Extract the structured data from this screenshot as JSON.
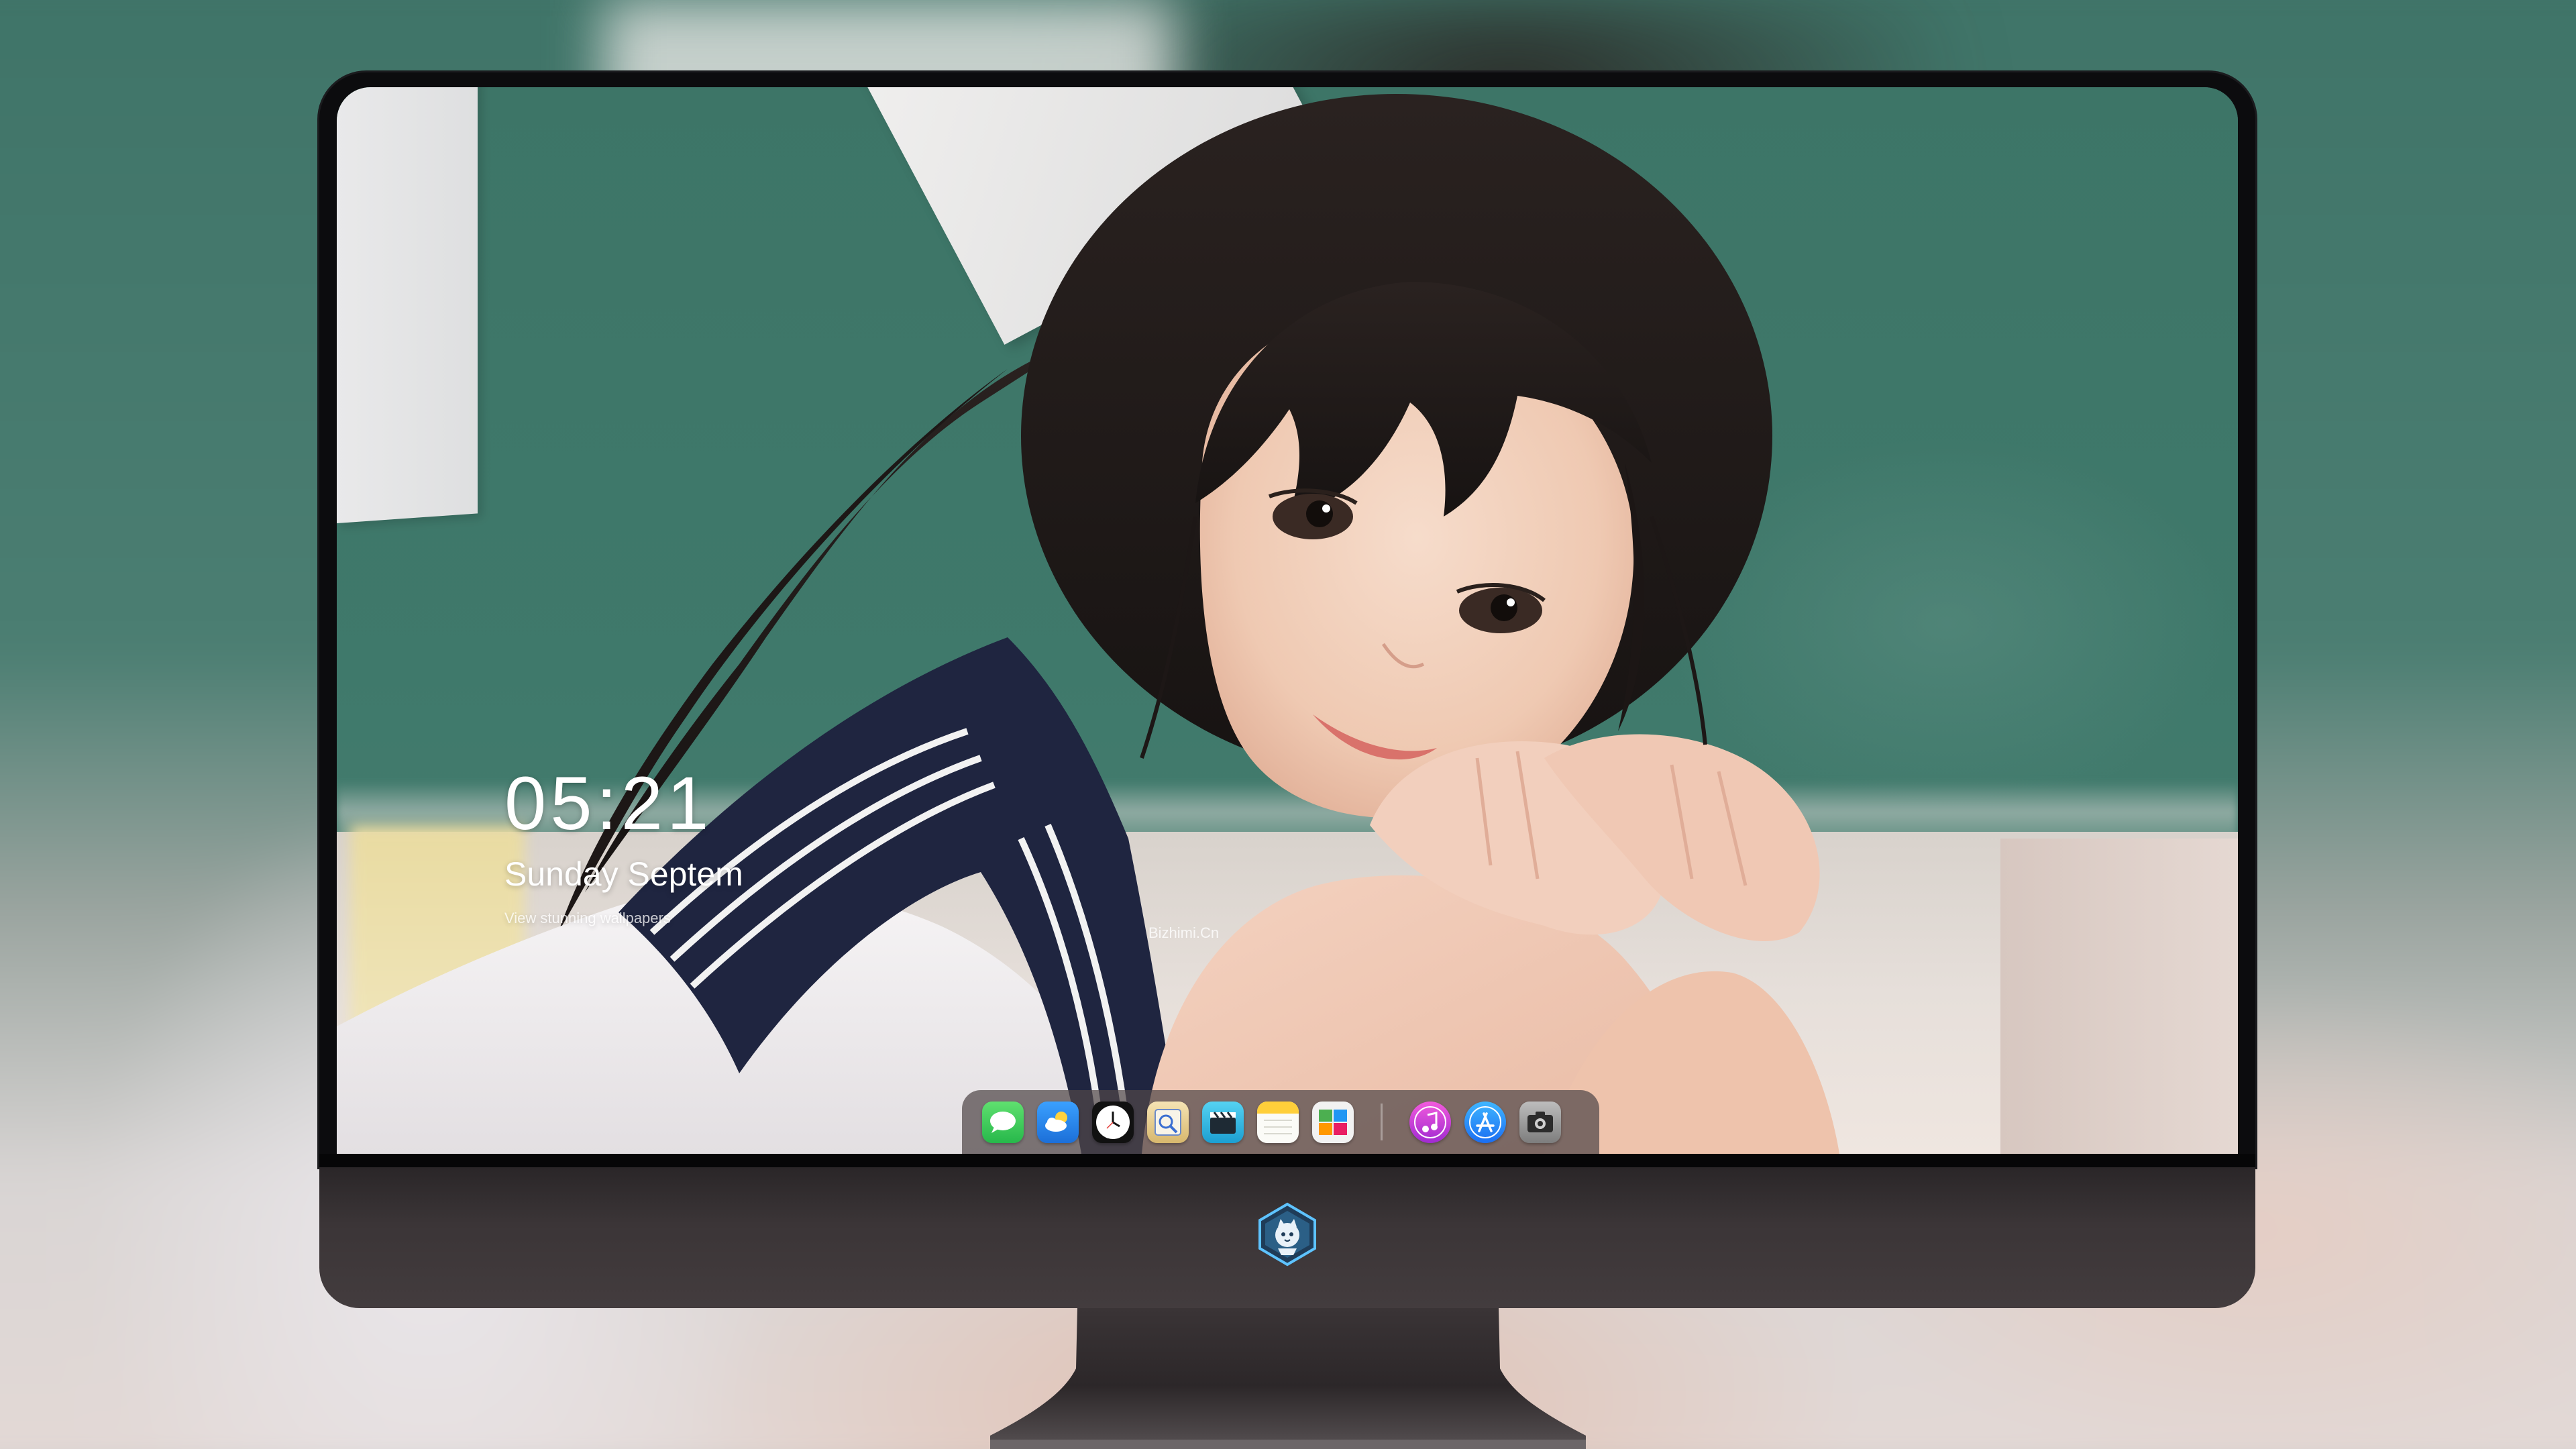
{
  "lockscreen": {
    "time": "05:21",
    "date": "Sunday Septem",
    "caption": "View stunning wallpapers",
    "credit": "Bizhimi.Cn"
  },
  "dock": {
    "apps": [
      {
        "name": "messages-icon",
        "color": "#35c759"
      },
      {
        "name": "weather-icon",
        "color": "#2f8ef0"
      },
      {
        "name": "clock-icon",
        "color": "#1a1a1a"
      },
      {
        "name": "preview-icon",
        "color": "#e9d6a0"
      },
      {
        "name": "video-clapper-icon",
        "color": "#2fb6e6"
      },
      {
        "name": "notes-icon",
        "color": "#ffd84a"
      },
      {
        "name": "photos-gallery-icon",
        "color": "#f2f2f2"
      },
      {
        "name": "music-icon",
        "color": "#d04bd7"
      },
      {
        "name": "app-store-icon",
        "color": "#1e88f5"
      },
      {
        "name": "camera-icon",
        "color": "#8a8a8a"
      }
    ]
  },
  "monitor": {
    "bezel_color": "#0c0c0e",
    "chin_color": "#3b3537",
    "logo": "cat-mascot-logo"
  }
}
